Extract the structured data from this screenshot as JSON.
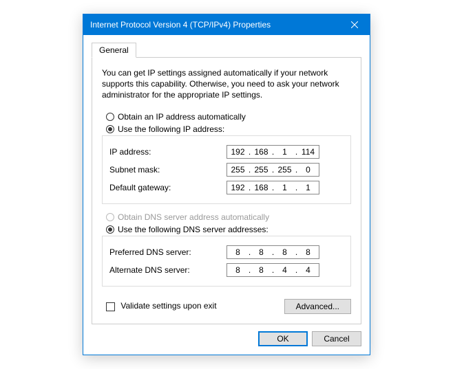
{
  "title": "Internet Protocol Version 4 (TCP/IPv4) Properties",
  "tab": {
    "general": "General"
  },
  "intro": "You can get IP settings assigned automatically if your network supports this capability. Otherwise, you need to ask your network administrator for the appropriate IP settings.",
  "ip": {
    "auto_label_pre": "O",
    "auto_label_post": "btain an IP address automatically",
    "manual_label_pre": "U",
    "manual_label_post": "se the following IP address:",
    "address_label_pre": "I",
    "address_label_post": "P address:",
    "address": {
      "o1": "192",
      "o2": "168",
      "o3": "1",
      "o4": "114"
    },
    "subnet_label_pre": "S",
    "subnet_label_post": "ubnet mask:",
    "subnet": {
      "o1": "255",
      "o2": "255",
      "o3": "255",
      "o4": "0"
    },
    "gateway_label_pre": "D",
    "gateway_label_post": "efault gateway:",
    "gateway": {
      "o1": "192",
      "o2": "168",
      "o3": "1",
      "o4": "1"
    }
  },
  "dns": {
    "auto_label_pre": "O",
    "auto_label_post": "btain DNS server address automatically",
    "manual_label_pre": "Us",
    "manual_label_post": "e the following DNS server addresses:",
    "preferred_label_pre": "P",
    "preferred_label_post": "referred DNS server:",
    "preferred": {
      "o1": "8",
      "o2": "8",
      "o3": "8",
      "o4": "8"
    },
    "alternate_label_pre": "A",
    "alternate_label_post": "lternate DNS server:",
    "alternate": {
      "o1": "8",
      "o2": "8",
      "o3": "4",
      "o4": "4"
    }
  },
  "validate_label_pre": "V",
  "validate_label_post": "alidate settings upon exit",
  "buttons": {
    "advanced": "Advanced...",
    "ok": "OK",
    "cancel": "Cancel"
  }
}
